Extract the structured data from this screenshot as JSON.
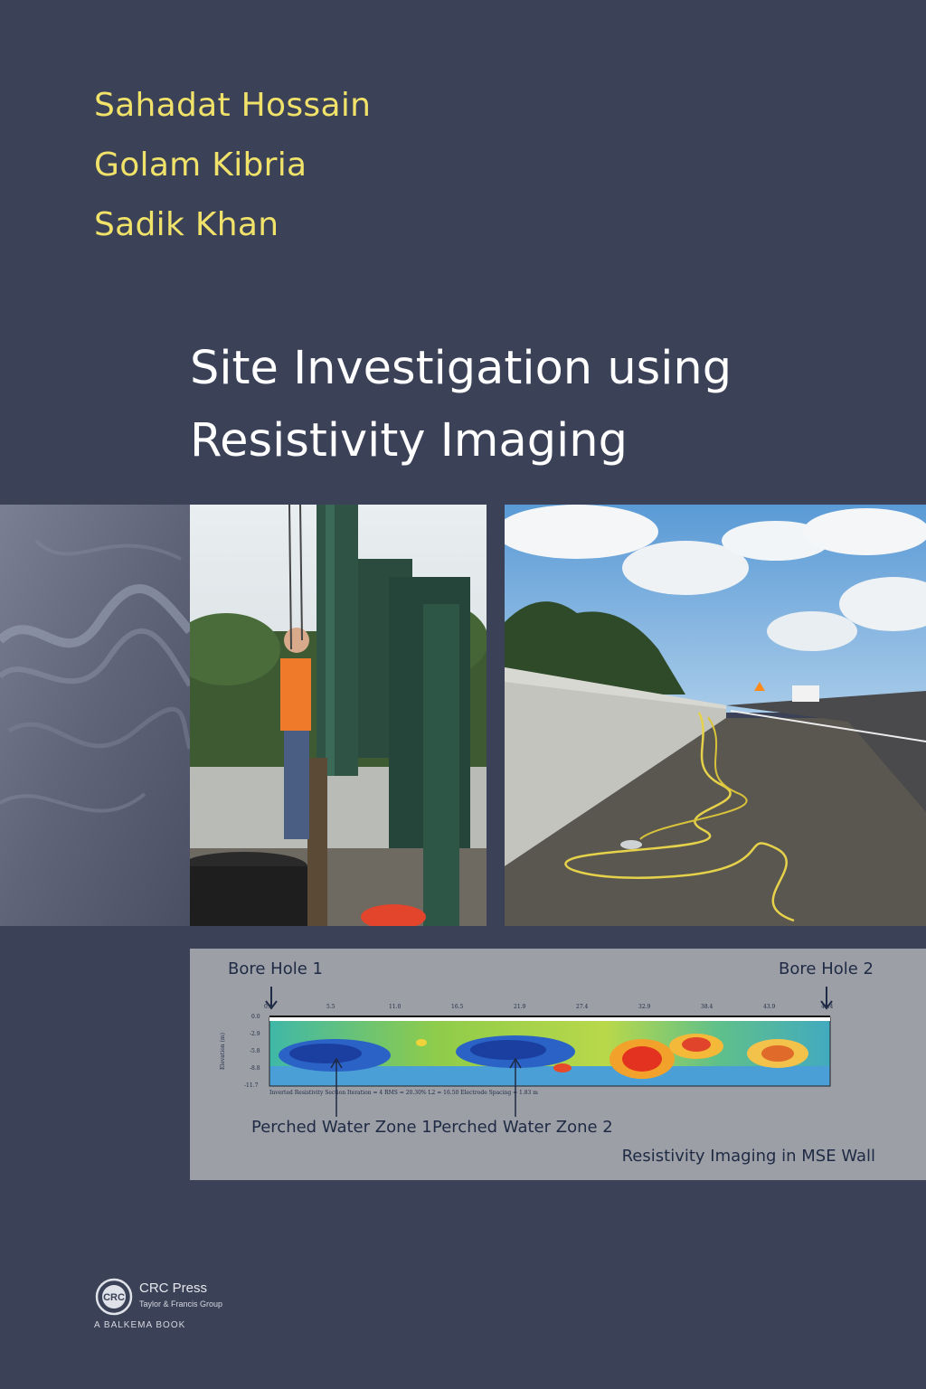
{
  "cover": {
    "authors": [
      "Sahadat Hossain",
      "Golam Kibria",
      "Sadik Khan"
    ],
    "title_line1": "Site Investigation using",
    "title_line2": "Resistivity Imaging"
  },
  "figure": {
    "bore_hole_1": "Bore Hole 1",
    "bore_hole_2": "Bore Hole 2",
    "zone_1": "Perched Water Zone 1",
    "zone_2": "Perched Water Zone 2",
    "caption": "Resistivity Imaging in MSE Wall",
    "x_ticks": [
      "0.0",
      "5.5",
      "11.0",
      "16.5",
      "21.9",
      "27.4",
      "32.9",
      "38.4",
      "43.9",
      "49.4"
    ],
    "y_ticks": [
      "0.0",
      "-2.9",
      "-5.8",
      "-8.8",
      "-11.7"
    ],
    "y_axis_label": "Elevation (m)",
    "footer": "Inverted Resistivity Section    Iteration = 4    RMS = 20.30%    L2 = 16.50    Electrode Spacing = 1.83 m"
  },
  "publisher": {
    "logo_text": "CRC",
    "name": "CRC Press",
    "group": "Taylor & Francis Group",
    "imprint": "A BALKEMA BOOK"
  },
  "colors": {
    "background": "#3b4157",
    "author_text": "#f1e26a",
    "title_text": "#ffffff",
    "panel": "#9c9fa6",
    "panel_text": "#1f2a44"
  }
}
